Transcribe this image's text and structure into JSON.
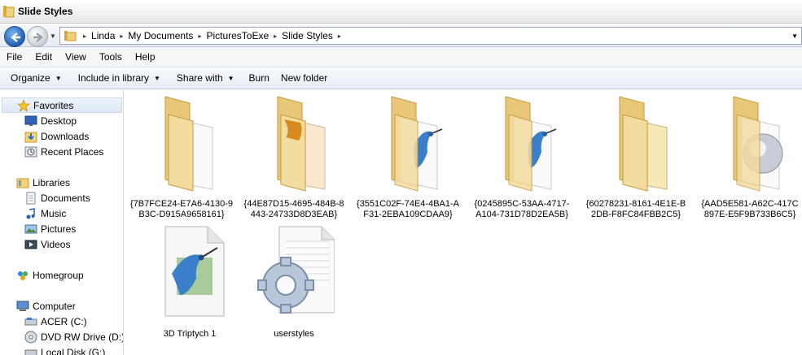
{
  "window": {
    "title": "Slide Styles"
  },
  "address": {
    "breadcrumbs": [
      "Linda",
      "My Documents",
      "PicturesToExe",
      "Slide Styles"
    ]
  },
  "menu": {
    "items": [
      "File",
      "Edit",
      "View",
      "Tools",
      "Help"
    ]
  },
  "commands": {
    "organize": "Organize",
    "include_in_library": "Include in library",
    "share_with": "Share with",
    "burn": "Burn",
    "new_folder": "New folder"
  },
  "nav": {
    "favorites": "Favorites",
    "desktop": "Desktop",
    "downloads": "Downloads",
    "recent_places": "Recent Places",
    "libraries": "Libraries",
    "documents": "Documents",
    "music": "Music",
    "pictures": "Pictures",
    "videos": "Videos",
    "homegroup": "Homegroup",
    "computer": "Computer",
    "acer": "ACER (C:)",
    "dvd": "DVD RW Drive (D:) P",
    "local_disk": "Local Disk (G:)"
  },
  "files": [
    {
      "line1": "{7B7FCE24-E7A6-4130-9",
      "line2": "B3C-D915A9658161}",
      "icon": "folder-blank-icon"
    },
    {
      "line1": "{44E87D15-4695-484B-8",
      "line2": "443-24733D8D3EAB}",
      "icon": "folder-orange-icon"
    },
    {
      "line1": "{3551C02F-74E4-4BA1-A",
      "line2": "F31-2EBA109CDAA9}",
      "icon": "folder-hummingbird-icon"
    },
    {
      "line1": "{0245895C-53AA-4717-",
      "line2": "A104-731D78D2EA5B}",
      "icon": "folder-hummingbird-icon"
    },
    {
      "line1": "{60278231-8161-4E1E-B",
      "line2": "2DB-F8FC84FBB2C5}",
      "icon": "folder-blank-icon"
    },
    {
      "line1": "{AAD5E581-A62C-417C",
      "line2": "897E-E5F9B733B6C5}",
      "icon": "folder-sphere-icon"
    }
  ],
  "files2": [
    {
      "line1": "3D Triptych 1",
      "icon": "hummingbird-document-icon"
    },
    {
      "line1": "userstyles",
      "icon": "settings-file-icon"
    }
  ]
}
